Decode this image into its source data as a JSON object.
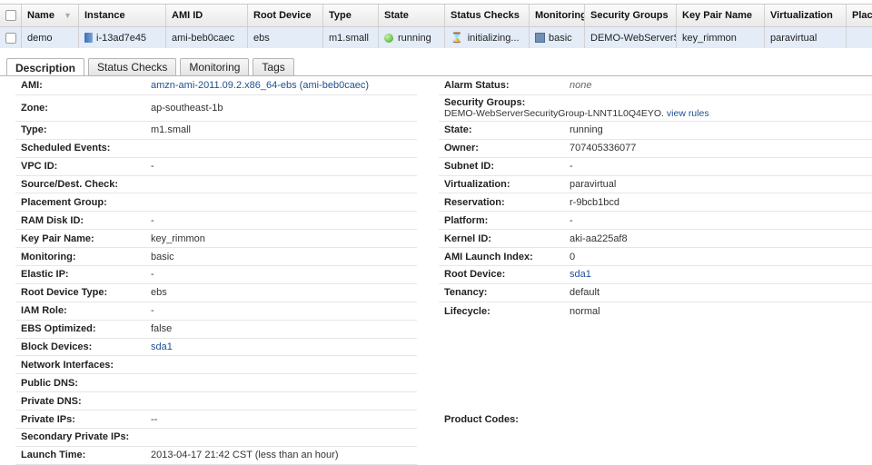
{
  "grid": {
    "columns": [
      "Name",
      "Instance",
      "AMI ID",
      "Root Device",
      "Type",
      "State",
      "Status Checks",
      "Monitoring",
      "Security Groups",
      "Key Pair Name",
      "Virtualization",
      "Plac"
    ],
    "row": {
      "name": "demo",
      "instance": "i-13ad7e45",
      "ami_id": "ami-beb0caec",
      "root_device": "ebs",
      "type": "m1.small",
      "state": "running",
      "status_checks": "initializing...",
      "monitoring": "basic",
      "security_groups": "DEMO-WebServerS",
      "key_pair": "key_rimmon",
      "virtualization": "paravirtual",
      "placement": ""
    }
  },
  "tabs": [
    "Description",
    "Status Checks",
    "Monitoring",
    "Tags"
  ],
  "left": [
    {
      "label": "AMI:",
      "value": "amzn-ami-2011.09.2.x86_64-ebs (ami-beb0caec)"
    },
    {
      "label": "Zone:",
      "value": "ap-southeast-1b"
    },
    {
      "label": "Type:",
      "value": "m1.small"
    },
    {
      "label": "Scheduled Events:",
      "value": ""
    },
    {
      "label": "VPC ID:",
      "value": "-"
    },
    {
      "label": "Source/Dest. Check:",
      "value": ""
    },
    {
      "label": "Placement Group:",
      "value": ""
    },
    {
      "label": "RAM Disk ID:",
      "value": "-"
    },
    {
      "label": "Key Pair Name:",
      "value": "key_rimmon"
    },
    {
      "label": "Monitoring:",
      "value": "basic"
    },
    {
      "label": "Elastic IP:",
      "value": "-"
    },
    {
      "label": "Root Device Type:",
      "value": "ebs"
    },
    {
      "label": "IAM Role:",
      "value": "-"
    },
    {
      "label": "EBS Optimized:",
      "value": "false"
    },
    {
      "label": "Block Devices:",
      "value": "sda1"
    },
    {
      "label": "Network Interfaces:",
      "value": ""
    },
    {
      "label": "Public DNS:",
      "value": ""
    },
    {
      "label": "Private DNS:",
      "value": ""
    },
    {
      "label": "Private IPs:",
      "value": "--"
    },
    {
      "label": "Secondary Private IPs:",
      "value": ""
    },
    {
      "label": "Launch Time:",
      "value": "2013-04-17 21:42 CST (less than an hour)"
    }
  ],
  "right": {
    "alarm_status": {
      "label": "Alarm Status:",
      "value": "none"
    },
    "security_groups": {
      "label": "Security Groups:",
      "value": "DEMO-WebServerSecurityGroup-LNNT1L0Q4EYO.",
      "link": "view rules"
    },
    "rows": [
      {
        "label": "State:",
        "value": "running"
      },
      {
        "label": "Owner:",
        "value": "707405336077"
      },
      {
        "label": "Subnet ID:",
        "value": "-"
      },
      {
        "label": "Virtualization:",
        "value": "paravirtual"
      },
      {
        "label": "Reservation:",
        "value": "r-9bcb1bcd"
      },
      {
        "label": "Platform:",
        "value": "-"
      },
      {
        "label": "Kernel ID:",
        "value": "aki-aa225af8"
      },
      {
        "label": "AMI Launch Index:",
        "value": "0"
      },
      {
        "label": "Root Device:",
        "value": "sda1"
      },
      {
        "label": "Tenancy:",
        "value": "default"
      },
      {
        "label": "Lifecycle:",
        "value": "normal"
      }
    ],
    "product_codes": {
      "label": "Product Codes:",
      "value": ""
    }
  },
  "colors": {
    "link": "#1f4f8f",
    "selected_row": "#e3ecf7",
    "running": "#3aa31a"
  }
}
